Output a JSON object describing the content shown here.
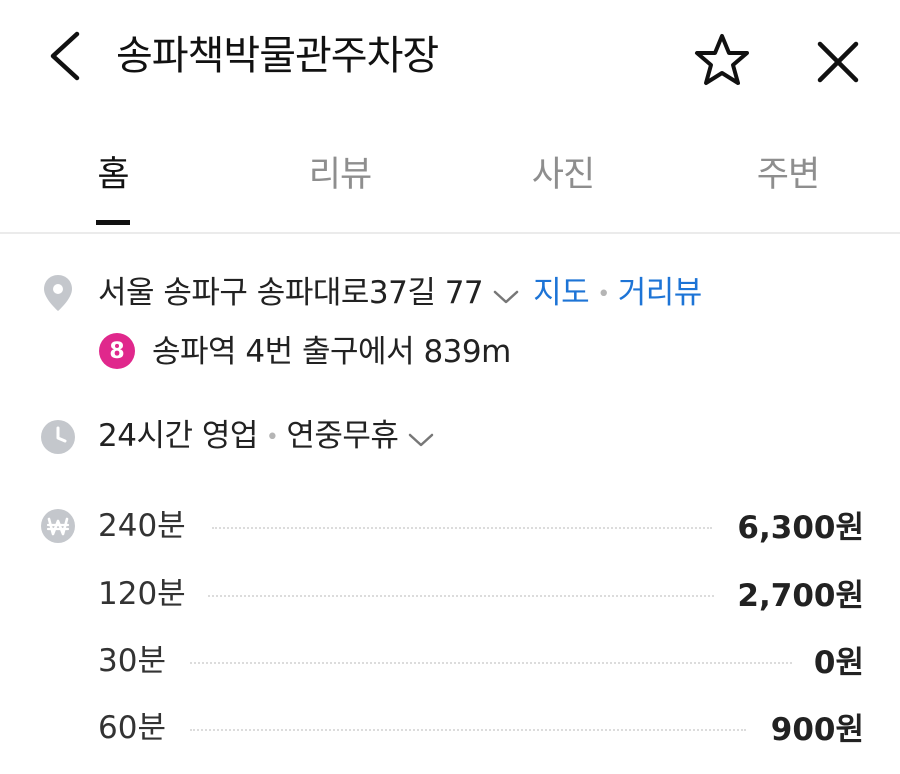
{
  "header": {
    "title": "송파책박물관주차장",
    "back_icon": "chevron-left-icon",
    "favorite_icon": "star-outline-icon",
    "close_icon": "close-icon"
  },
  "tabs": [
    {
      "label": "홈",
      "active": true
    },
    {
      "label": "리뷰",
      "active": false
    },
    {
      "label": "사진",
      "active": false
    },
    {
      "label": "주변",
      "active": false
    }
  ],
  "location": {
    "icon": "map-pin-icon",
    "address": "서울 송파구 송파대로37길 77",
    "map_link": "지도",
    "separator": "•",
    "street_view_link": "거리뷰",
    "subway": {
      "line": "8",
      "line_color": "#e0288c",
      "text": "송파역 4번 출구에서 839m"
    }
  },
  "hours": {
    "icon": "clock-icon",
    "status": "24시간 영업",
    "separator": "•",
    "closed_days": "연중무휴"
  },
  "fees": {
    "icon": "won-icon",
    "rows": [
      {
        "duration": "240분",
        "price": "6,300원"
      },
      {
        "duration": "120분",
        "price": "2,700원"
      },
      {
        "duration": "30분",
        "price": "0원"
      },
      {
        "duration": "60분",
        "price": "900원"
      }
    ]
  },
  "colors": {
    "link": "#1d74d6",
    "icon_gray": "#c4c7cc",
    "subway_line_8": "#e0288c"
  }
}
